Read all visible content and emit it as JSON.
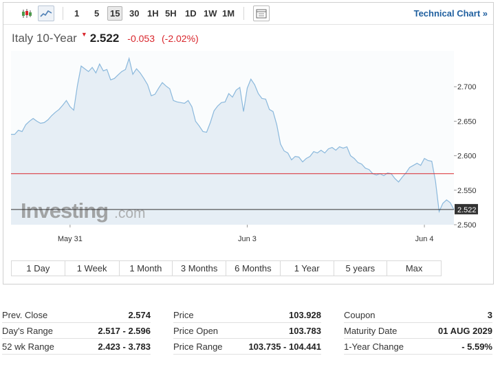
{
  "toolbar": {
    "periods": [
      "1",
      "5",
      "15",
      "30",
      "1H",
      "5H",
      "1D",
      "1W",
      "1M"
    ],
    "selected_period": "15",
    "technical_chart_label": "Technical Chart »"
  },
  "quote": {
    "name": "Italy 10-Year",
    "direction_glyph": "▼",
    "price": "2.522",
    "change": "-0.053",
    "change_pct": "(-2.02%)",
    "down_color": "#d9262c"
  },
  "watermark": {
    "brand": "Investing",
    "suffix": ".com"
  },
  "chart_data": {
    "type": "area",
    "title": "",
    "xlabel": "",
    "ylabel": "",
    "x_tick_labels": [
      "May 31",
      "Jun 3",
      "Jun 4"
    ],
    "y_ticks": [
      2.5,
      2.55,
      2.6,
      2.65,
      2.7
    ],
    "y_tick_labels": [
      "2.500",
      "2.550",
      "2.600",
      "2.650",
      "2.700"
    ],
    "ylim": [
      2.5,
      2.752
    ],
    "grid": false,
    "prev_close": 2.574,
    "prev_close_color": "#d9262c",
    "last_price": 2.522,
    "last_price_label": "2.522",
    "line_color": "#8ab8dc",
    "fill_color": "#e6eef5",
    "series": [
      {
        "values": [
          2.631,
          2.631,
          2.637,
          2.635,
          2.645,
          2.65,
          2.654,
          2.65,
          2.647,
          2.648,
          2.652,
          2.658,
          2.663,
          2.667,
          2.673,
          2.68,
          2.671,
          2.666,
          2.702,
          2.73,
          2.726,
          2.722,
          2.728,
          2.72,
          2.733,
          2.723,
          2.725,
          2.71,
          2.712,
          2.717,
          2.722,
          2.725,
          2.741,
          2.718,
          2.726,
          2.72,
          2.712,
          2.703,
          2.687,
          2.689,
          2.698,
          2.706,
          2.701,
          2.697,
          2.68,
          2.678,
          2.677,
          2.676,
          2.68,
          2.671,
          2.65,
          2.643,
          2.635,
          2.634,
          2.648,
          2.665,
          2.672,
          2.677,
          2.678,
          2.69,
          2.685,
          2.695,
          2.699,
          2.664,
          2.698,
          2.711,
          2.703,
          2.69,
          2.683,
          2.682,
          2.667,
          2.664,
          2.645,
          2.617,
          2.607,
          2.604,
          2.594,
          2.599,
          2.598,
          2.591,
          2.596,
          2.599,
          2.606,
          2.604,
          2.608,
          2.604,
          2.61,
          2.612,
          2.608,
          2.613,
          2.611,
          2.613,
          2.6,
          2.596,
          2.59,
          2.588,
          2.582,
          2.58,
          2.574,
          2.572,
          2.574,
          2.571,
          2.575,
          2.574,
          2.567,
          2.562,
          2.569,
          2.575,
          2.583,
          2.586,
          2.589,
          2.586,
          2.596,
          2.593,
          2.592,
          2.563,
          2.519,
          2.531,
          2.536,
          2.532,
          2.522
        ]
      }
    ]
  },
  "ranges": [
    "1 Day",
    "1 Week",
    "1 Month",
    "3 Months",
    "6 Months",
    "1 Year",
    "5 years",
    "Max"
  ],
  "stats": {
    "col1": [
      {
        "label": "Prev. Close",
        "value": "2.574"
      },
      {
        "label": "Day's Range",
        "value": "2.517 - 2.596"
      },
      {
        "label": "52 wk Range",
        "value": "2.423 - 3.783"
      }
    ],
    "col2": [
      {
        "label": "Price",
        "value": "103.928"
      },
      {
        "label": "Price Open",
        "value": "103.783"
      },
      {
        "label": "Price Range",
        "value": "103.735 - 104.441"
      }
    ],
    "col3": [
      {
        "label": "Coupon",
        "value": "3"
      },
      {
        "label": "Maturity Date",
        "value": "01 AUG 2029"
      },
      {
        "label": "1-Year Change",
        "value": "- 5.59%"
      }
    ]
  }
}
